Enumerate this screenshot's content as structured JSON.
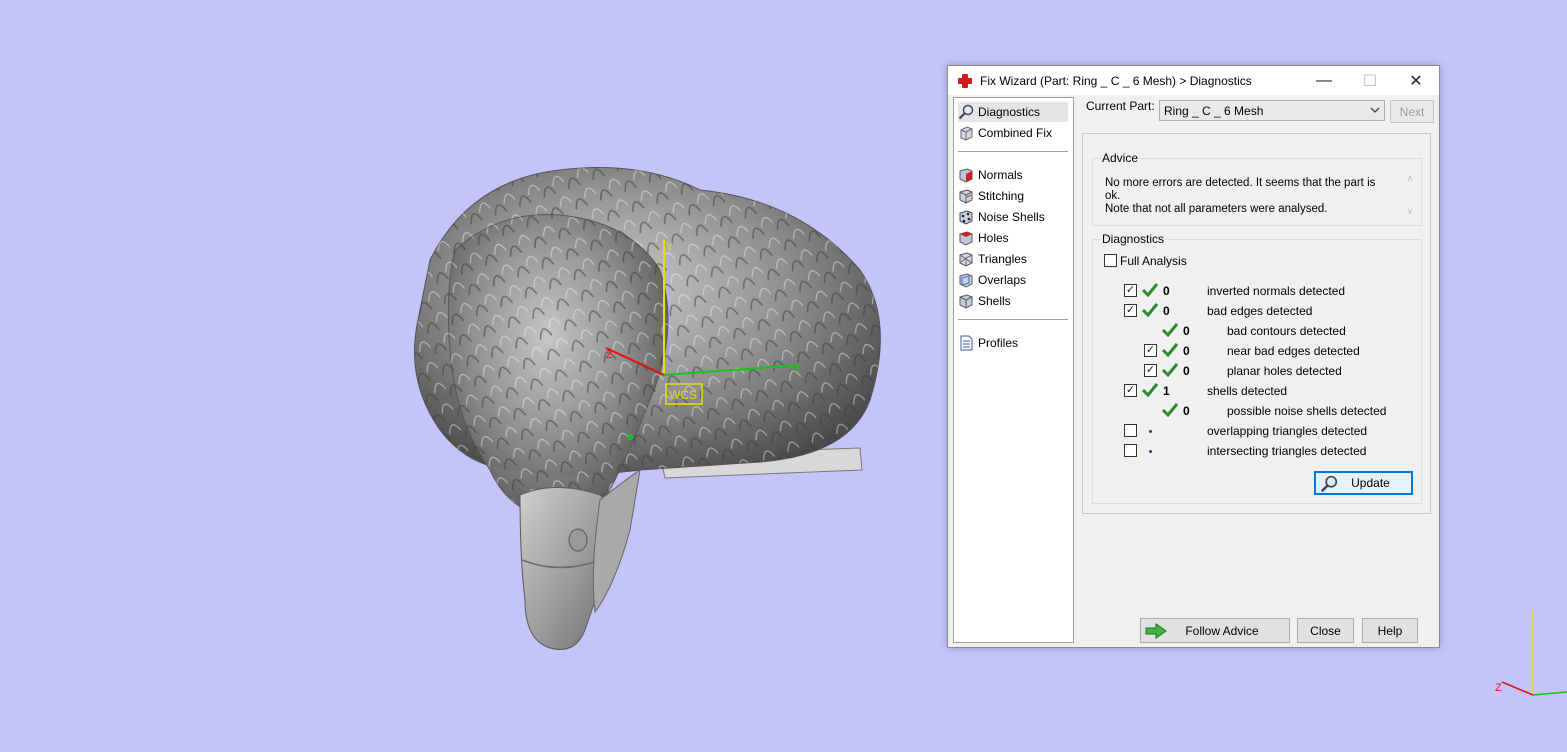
{
  "dialog": {
    "title": "Fix Wizard (Part: Ring _ C _ 6 Mesh) > Diagnostics",
    "window_buttons": {
      "minimize": "—",
      "maximize": "☐",
      "close": "✕"
    }
  },
  "nav": {
    "top_items": [
      {
        "label": "Diagnostics",
        "icon": "magnifier-icon",
        "selected": true
      },
      {
        "label": "Combined Fix",
        "icon": "cube-icon",
        "selected": false
      }
    ],
    "fix_items": [
      {
        "label": "Normals",
        "icon": "normals-cube-icon"
      },
      {
        "label": "Stitching",
        "icon": "stitching-cube-icon"
      },
      {
        "label": "Noise Shells",
        "icon": "noise-shells-icon"
      },
      {
        "label": "Holes",
        "icon": "holes-cube-icon"
      },
      {
        "label": "Triangles",
        "icon": "triangles-cube-icon"
      },
      {
        "label": "Overlaps",
        "icon": "overlaps-cube-icon"
      },
      {
        "label": "Shells",
        "icon": "shells-cube-icon"
      }
    ],
    "bottom_items": [
      {
        "label": "Profiles",
        "icon": "profiles-document-icon"
      }
    ]
  },
  "current_part": {
    "label": "Current Part:",
    "value": "Ring _ C _ 6 Mesh",
    "next_button": "Next"
  },
  "advice": {
    "title": "Advice",
    "text": "No more errors are detected. It seems that the part is ok.\nNote that not all parameters were analysed."
  },
  "diagnostics": {
    "title": "Diagnostics",
    "full_analysis_label": "Full Analysis",
    "full_analysis_checked": false,
    "rows": [
      {
        "checkbox": true,
        "checked": true,
        "status": "ok",
        "count": "0",
        "label": "inverted normals detected",
        "indent": 0
      },
      {
        "checkbox": true,
        "checked": true,
        "status": "ok",
        "count": "0",
        "label": "bad edges detected",
        "indent": 0
      },
      {
        "checkbox": false,
        "checked": false,
        "status": "ok",
        "count": "0",
        "label": "bad contours detected",
        "indent": 1
      },
      {
        "checkbox": true,
        "checked": true,
        "status": "ok",
        "count": "0",
        "label": "near bad edges detected",
        "indent": 1
      },
      {
        "checkbox": true,
        "checked": true,
        "status": "ok",
        "count": "0",
        "label": "planar holes detected",
        "indent": 1
      },
      {
        "checkbox": true,
        "checked": true,
        "status": "ok",
        "count": "1",
        "label": "shells detected",
        "indent": 0
      },
      {
        "checkbox": false,
        "checked": false,
        "status": "ok",
        "count": "0",
        "label": "possible noise shells detected",
        "indent": 1
      },
      {
        "checkbox": true,
        "checked": false,
        "status": "dot",
        "count": "",
        "label": "overlapping triangles detected",
        "indent": 0
      },
      {
        "checkbox": true,
        "checked": false,
        "status": "dot",
        "count": "",
        "label": "intersecting triangles detected",
        "indent": 0
      }
    ],
    "update_button": "Update"
  },
  "footer": {
    "follow_advice": "Follow Advice",
    "close": "Close",
    "help": "Help"
  },
  "viewport": {
    "wcs_label": "WCS",
    "axis_labels": {
      "y": "Y",
      "z": "Z",
      "x": "X"
    },
    "corner_axis_labels": {
      "z": "Z"
    }
  },
  "colors": {
    "background": "#c4c4fa",
    "check_green": "#2e8b2e",
    "selection_blue": "#0078d7",
    "axis_y": "#e8e000",
    "axis_x": "#19c419",
    "axis_z": "#e01010"
  }
}
